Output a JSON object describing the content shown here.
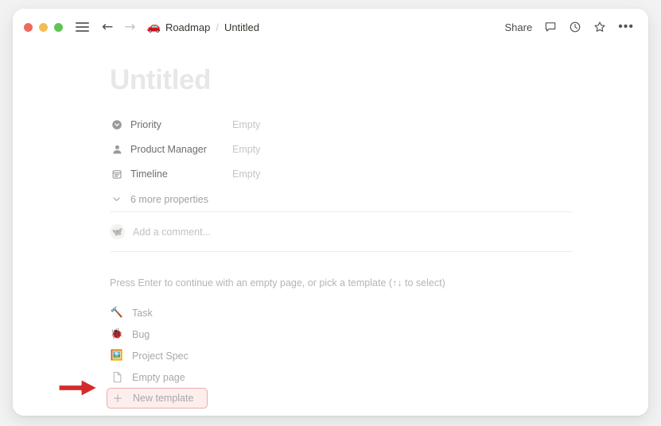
{
  "window": {
    "traffic_lights": [
      "close",
      "minimize",
      "maximize"
    ]
  },
  "titlebar": {
    "menu_icon": "hamburger-icon",
    "back_icon": "arrow-left-icon",
    "forward_icon": "arrow-right-icon",
    "breadcrumb": {
      "emoji": "🚗",
      "parent": "Roadmap",
      "separator": "/",
      "current": "Untitled"
    },
    "share_label": "Share",
    "comment_icon": "comment-icon",
    "history_icon": "clock-icon",
    "favorite_icon": "star-icon",
    "more_icon": "ellipsis-icon",
    "more_glyph": "•••"
  },
  "page": {
    "title": "Untitled",
    "properties": [
      {
        "icon": "select-icon",
        "name": "Priority",
        "value": "Empty"
      },
      {
        "icon": "person-icon",
        "name": "Product Manager",
        "value": "Empty"
      },
      {
        "icon": "calendar-icon",
        "name": "Timeline",
        "value": "Empty"
      }
    ],
    "more_properties_label": "6 more properties",
    "more_properties_icon": "chevron-down-icon",
    "comment": {
      "avatar_emoji": "🦋",
      "placeholder": "Add a comment..."
    },
    "template_prompt": "Press Enter to continue with an empty page, or pick a template (↑↓ to select)",
    "templates": [
      {
        "emoji": "🔨",
        "icon": "hammer-icon",
        "label": "Task"
      },
      {
        "emoji": "🐞",
        "icon": "ladybug-icon",
        "label": "Bug"
      },
      {
        "emoji": "🖼️",
        "icon": "picture-icon",
        "label": "Project Spec"
      },
      {
        "emoji": "",
        "icon": "document-icon",
        "label": "Empty page"
      }
    ],
    "new_template": {
      "plus_glyph": "+",
      "label": "New template",
      "highlight_border_color": "#f0a9a9",
      "highlight_background_color": "#fdeeee"
    }
  },
  "annotation": {
    "arrow_color": "#d32b2b",
    "arrow_outline_color": "#ffffff",
    "points_to": "New template"
  }
}
